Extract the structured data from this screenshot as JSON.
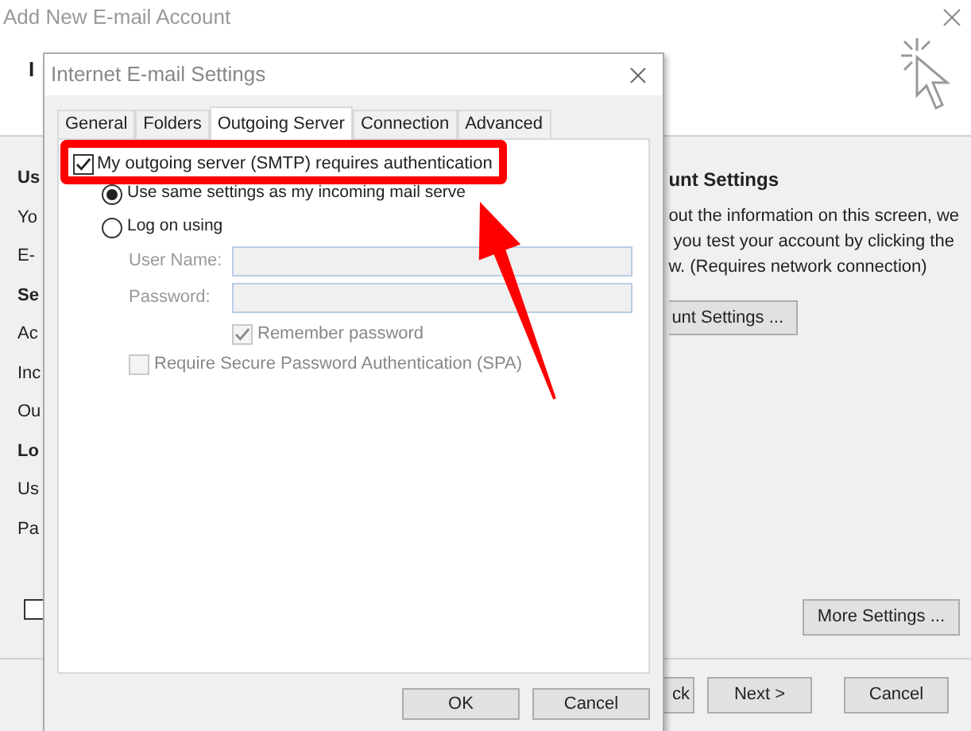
{
  "background_window": {
    "title": "Add New E-mail Account",
    "header_text": "I",
    "left_labels": [
      {
        "text": "Us",
        "kind": "heading"
      },
      {
        "text": "Yo",
        "kind": "label"
      },
      {
        "text": "E-",
        "kind": "label"
      },
      {
        "text": "Se",
        "kind": "heading"
      },
      {
        "text": "Ac",
        "kind": "label"
      },
      {
        "text": "Inc",
        "kind": "label"
      },
      {
        "text": "Ou",
        "kind": "label"
      },
      {
        "text": "Lo",
        "kind": "heading"
      },
      {
        "text": "Us",
        "kind": "label"
      },
      {
        "text": "Pa",
        "kind": "label"
      }
    ],
    "account_settings": {
      "heading": "unt Settings",
      "description": "out the information on this screen, we\n you test your account by clicking the\nw. (Requires network connection)",
      "button": "unt Settings ..."
    },
    "bottom_checkbox": {
      "checked": false
    },
    "more_settings_button": "More Settings ...",
    "footer_buttons": [
      "ck",
      "Next >",
      "Cancel"
    ]
  },
  "dialog": {
    "title": "Internet E-mail Settings",
    "tabs": [
      {
        "label": "General",
        "selected": false
      },
      {
        "label": "Folders",
        "selected": false
      },
      {
        "label": "Outgoing Server",
        "selected": true
      },
      {
        "label": "Connection",
        "selected": false
      },
      {
        "label": "Advanced",
        "selected": false
      }
    ],
    "smtp_auth": {
      "label": "My outgoing server (SMTP) requires authentication",
      "checked": true
    },
    "options": [
      {
        "label": "Use same settings as my incoming mail serve",
        "selected": true
      },
      {
        "label": "Log on using",
        "selected": false
      }
    ],
    "fields": [
      {
        "label": "User Name:",
        "disabled": true
      },
      {
        "label": "Password:",
        "disabled": true
      }
    ],
    "remember_password": {
      "label": "Remember password",
      "checked": true,
      "disabled": true
    },
    "spa": {
      "label": "Require Secure Password Authentication (SPA)",
      "checked": false,
      "disabled": true
    },
    "buttons": [
      "OK",
      "Cancel"
    ]
  }
}
